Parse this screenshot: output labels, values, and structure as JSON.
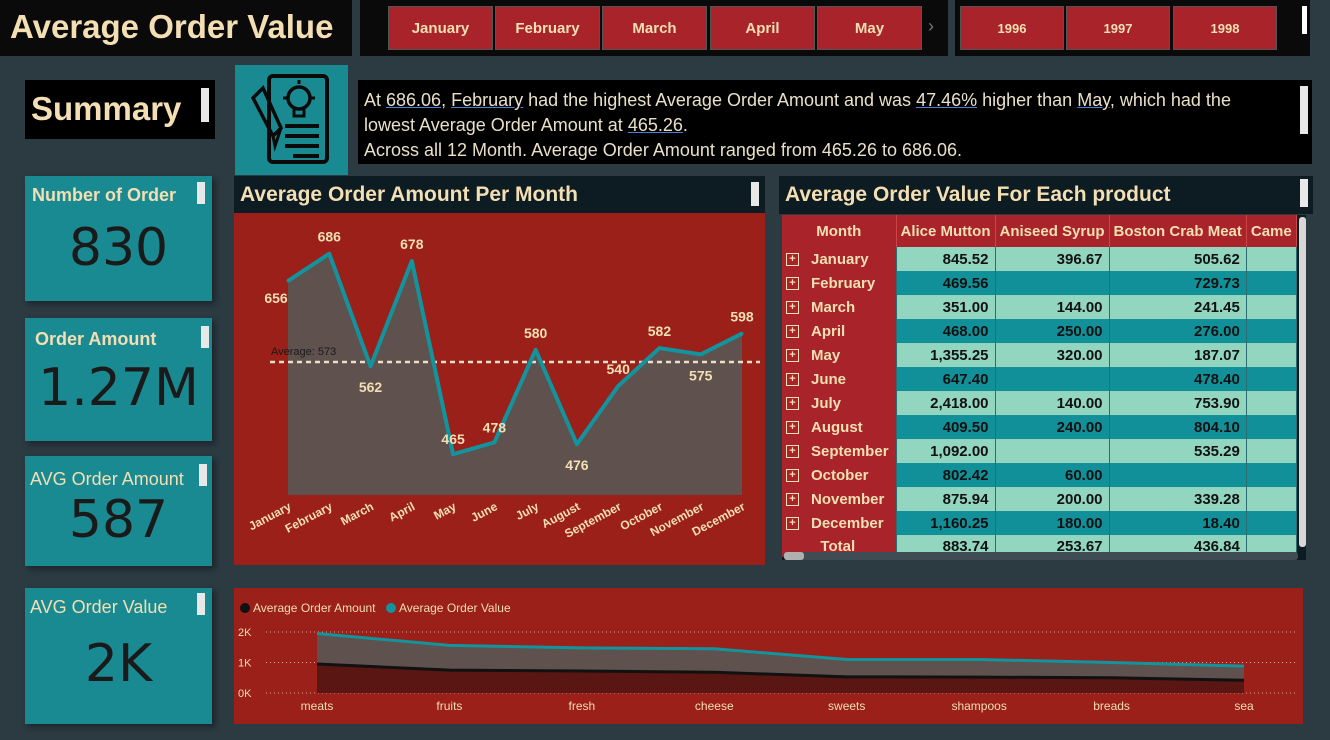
{
  "header": {
    "title": "Average Order Value",
    "months": [
      "January",
      "February",
      "March",
      "April",
      "May"
    ],
    "years": [
      "1996",
      "1997",
      "1998"
    ]
  },
  "summary": {
    "heading": "Summary",
    "text_parts": {
      "p1": "At ",
      "max_value": "686.06",
      "p2": ", ",
      "max_month": "February",
      "p3": " had the highest Average Order Amount and was ",
      "pct": "47.46%",
      "p4": " higher than ",
      "min_month": "May",
      "p5": ", which had the lowest Average Order Amount at ",
      "min_value": "465.26",
      "p6": ".",
      "line2": "Across all 12 Month. Average Order Amount ranged from 465.26 to 686.06."
    },
    "icon": "document-lightbulb-icon"
  },
  "kpis": {
    "orders_label": "Number of Order",
    "orders_value": "830",
    "amount_label": "Order Amount",
    "amount_value": "1.27M",
    "avg_amount_label": "AVG Order Amount",
    "avg_amount_value": "587",
    "avg_value_label": "AVG Order Value",
    "avg_value_value": "2K"
  },
  "line_chart": {
    "heading": "Average Order Amount Per Month",
    "average_label": "Average: 573"
  },
  "table": {
    "heading": "Average Order Value For Each product",
    "columns": [
      "Month",
      "Alice Mutton",
      "Aniseed Syrup",
      "Boston Crab Meat",
      "Came"
    ],
    "rows": [
      [
        "January",
        "845.52",
        "396.67",
        "505.62"
      ],
      [
        "February",
        "469.56",
        "",
        "729.73"
      ],
      [
        "March",
        "351.00",
        "144.00",
        "241.45"
      ],
      [
        "April",
        "468.00",
        "250.00",
        "276.00"
      ],
      [
        "May",
        "1,355.25",
        "320.00",
        "187.07"
      ],
      [
        "June",
        "647.40",
        "",
        "478.40"
      ],
      [
        "July",
        "2,418.00",
        "140.00",
        "753.90"
      ],
      [
        "August",
        "409.50",
        "240.00",
        "804.10"
      ],
      [
        "September",
        "1,092.00",
        "",
        "535.29"
      ],
      [
        "October",
        "802.42",
        "60.00",
        ""
      ],
      [
        "November",
        "875.94",
        "200.00",
        "339.28"
      ],
      [
        "December",
        "1,160.25",
        "180.00",
        "18.40"
      ]
    ],
    "total": [
      "Total",
      "883.74",
      "253.67",
      "436.84"
    ]
  },
  "area_chart": {
    "legend": [
      "Average Order Amount",
      "Average Order Value"
    ]
  },
  "colors": {
    "teal": "#1a8a92",
    "red": "#9a2019",
    "cream": "#f3dfb3",
    "line_teal": "#12949e"
  },
  "chart_data": [
    {
      "type": "area",
      "title": "Average Order Amount Per Month",
      "categories": [
        "January",
        "February",
        "March",
        "April",
        "May",
        "June",
        "July",
        "August",
        "September",
        "October",
        "November",
        "December"
      ],
      "values": [
        656,
        686,
        562,
        678,
        465,
        478,
        580,
        476,
        540,
        582,
        575,
        598
      ],
      "data_labels": [
        "656",
        "686",
        "562",
        "678",
        "465",
        "478",
        "580",
        "476",
        "540",
        "582",
        "575",
        "598"
      ],
      "average": 573,
      "ylim": [
        420,
        700
      ]
    },
    {
      "type": "area",
      "categories": [
        "meats",
        "fruits",
        "fresh",
        "cheese",
        "sweets",
        "shampoos",
        "breads",
        "sea"
      ],
      "y_ticks": [
        "0K",
        "1K",
        "2K"
      ],
      "ylim": [
        0,
        2000
      ],
      "series": [
        {
          "name": "Average Order Amount",
          "values": [
            950,
            750,
            720,
            680,
            530,
            520,
            500,
            420
          ]
        },
        {
          "name": "Average Order Value",
          "values": [
            1950,
            1560,
            1480,
            1450,
            1100,
            1100,
            1000,
            880
          ]
        }
      ],
      "legend": "top-left"
    }
  ]
}
